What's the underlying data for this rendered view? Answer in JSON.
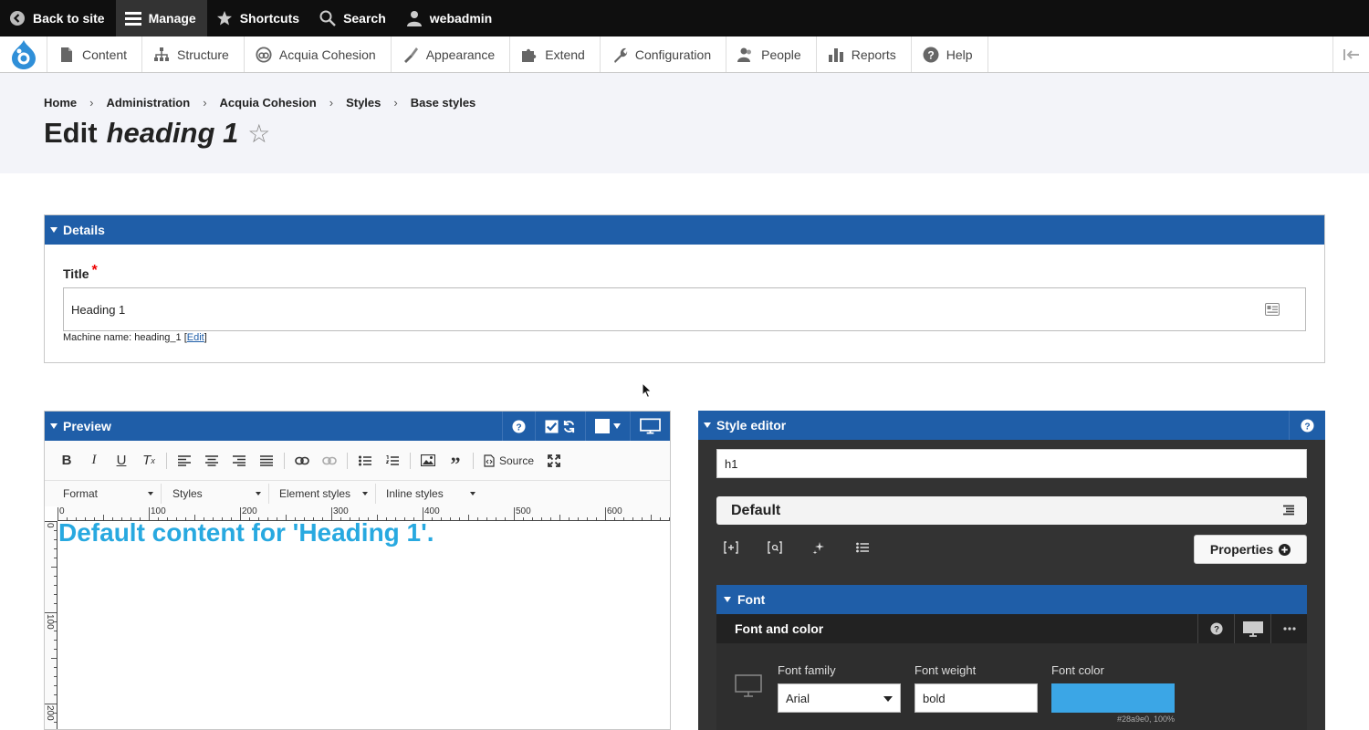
{
  "toolbar": {
    "back": "Back to site",
    "manage": "Manage",
    "shortcuts": "Shortcuts",
    "search": "Search",
    "user": "webadmin"
  },
  "tray": {
    "items": [
      "Content",
      "Structure",
      "Acquia Cohesion",
      "Appearance",
      "Extend",
      "Configuration",
      "People",
      "Reports",
      "Help"
    ]
  },
  "breadcrumb": [
    "Home",
    "Administration",
    "Acquia Cohesion",
    "Styles",
    "Base styles"
  ],
  "page": {
    "title_prefix": "Edit",
    "title_name": "heading 1",
    "star": "☆"
  },
  "details": {
    "header": "Details",
    "title_label": "Title",
    "required_mark": "*",
    "title_value": "Heading 1",
    "machine_prefix": "Machine name: heading_1 ",
    "machine_edit": "Edit"
  },
  "preview": {
    "header": "Preview",
    "source_label": "Source",
    "combos": [
      "Format",
      "Styles",
      "Element styles",
      "Inline styles"
    ],
    "ruler_h": [
      "0",
      "100",
      "200",
      "300",
      "400",
      "500",
      "600"
    ],
    "ruler_v": [
      "0",
      "100",
      "200"
    ],
    "content": "Default content for 'Heading 1'.",
    "content_color": "#28a9e0"
  },
  "style_editor": {
    "header": "Style editor",
    "selector": "h1",
    "default_label": "Default",
    "properties_label": "Properties",
    "font_section": "Font",
    "font_and_color": "Font and color",
    "font_family_label": "Font family",
    "font_family_value": "Arial",
    "font_weight_label": "Font weight",
    "font_weight_value": "bold",
    "font_color_label": "Font color",
    "font_color_value": "#28a9e0, 100%",
    "font_color_hex": "#3ba6e6"
  },
  "colors": {
    "accent": "#1f5ea8",
    "toolbar": "#0f0f0f",
    "header_bg": "#f3f4f9"
  }
}
